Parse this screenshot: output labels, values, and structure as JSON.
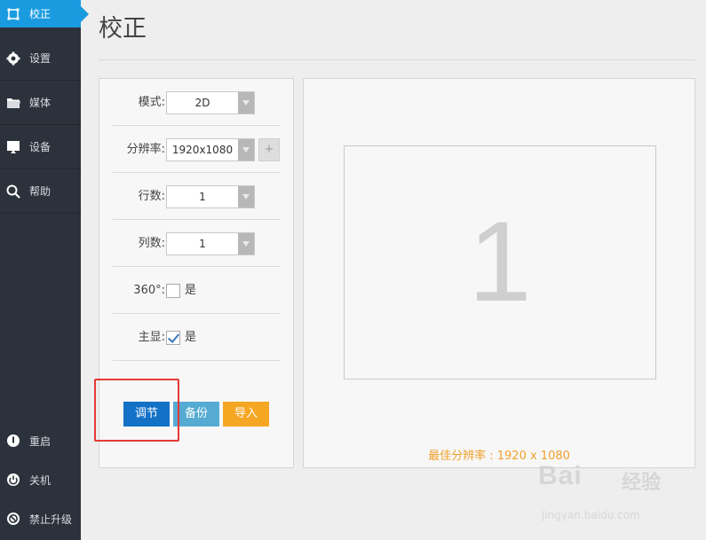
{
  "sidebar": {
    "items": [
      {
        "label": "校正",
        "icon": "calibrate-icon"
      },
      {
        "label": "设置",
        "icon": "gear-icon"
      },
      {
        "label": "媒体",
        "icon": "folder-icon"
      },
      {
        "label": "设备",
        "icon": "monitor-icon"
      },
      {
        "label": "帮助",
        "icon": "search-icon"
      }
    ],
    "bottom": [
      {
        "label": "重启",
        "icon": "restart-icon"
      },
      {
        "label": "关机",
        "icon": "power-icon"
      },
      {
        "label": "禁止升级",
        "icon": "no-upgrade-icon"
      }
    ]
  },
  "header": {
    "title": "校正"
  },
  "settings": {
    "mode": {
      "label": "模式:",
      "value": "2D"
    },
    "resolution": {
      "label": "分辨率:",
      "value": "1920x1080",
      "add_label": "+"
    },
    "rows": {
      "label": "行数:",
      "value": "1"
    },
    "cols": {
      "label": "列数:",
      "value": "1"
    },
    "panorama": {
      "label": "360°:",
      "checkbox_label": "是",
      "checked": false
    },
    "primary": {
      "label": "主显:",
      "checkbox_label": "是",
      "checked": true
    }
  },
  "buttons": {
    "adjust": "调节",
    "backup": "备份",
    "import": "导入"
  },
  "preview": {
    "screen_number": "1",
    "best_resolution": "最佳分辨率 : 1920 x 1080"
  },
  "watermark": {
    "brand": "Bai",
    "brand_cn": "经验",
    "url": "jingyan.baidu.com"
  },
  "colors": {
    "accent": "#1a9be0",
    "sidebar": "#2c323b",
    "adjust": "#1371c6",
    "backup": "#56abd3",
    "import": "#f5a623",
    "highlight": "#e53935"
  }
}
